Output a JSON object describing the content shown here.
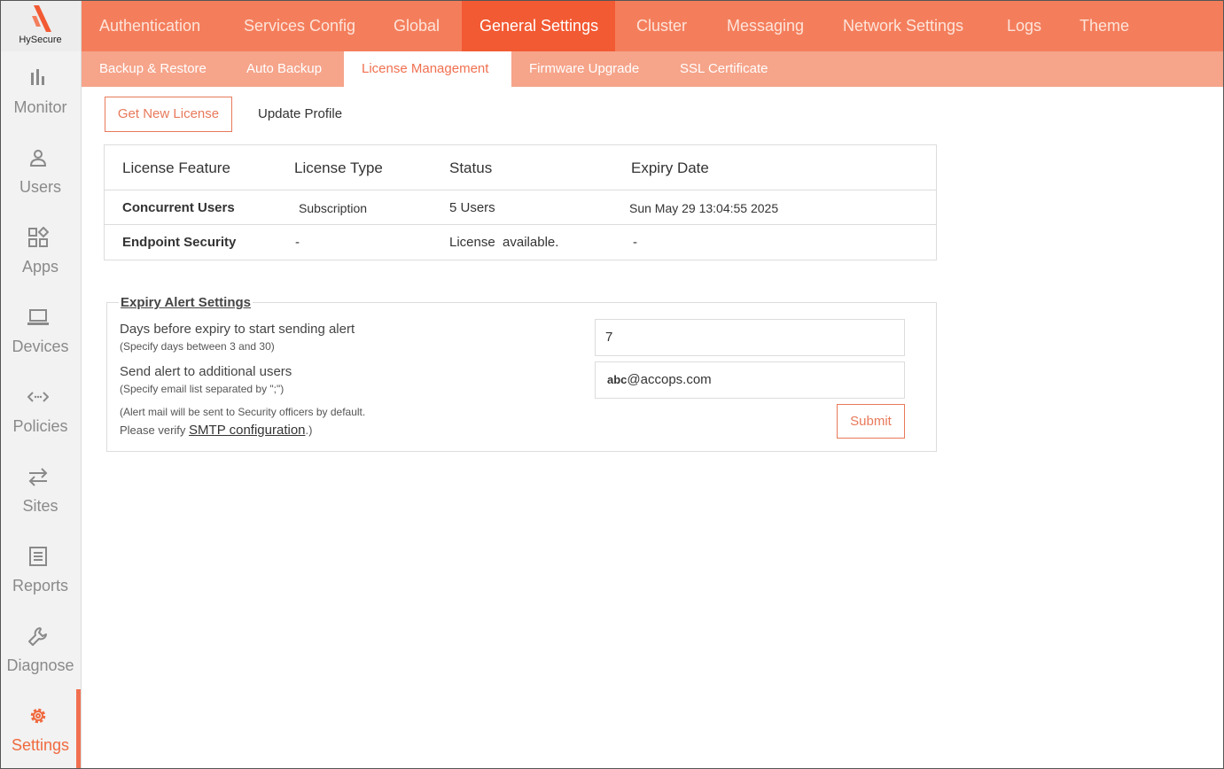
{
  "brand": {
    "name": "HySecure",
    "accent": "#f47e5c",
    "active": "#f25a33"
  },
  "sidebar": {
    "items": [
      {
        "label": "Monitor",
        "icon": "bar-chart-icon"
      },
      {
        "label": "Users",
        "icon": "user-icon"
      },
      {
        "label": "Apps",
        "icon": "apps-icon"
      },
      {
        "label": "Devices",
        "icon": "laptop-icon"
      },
      {
        "label": "Policies",
        "icon": "code-arrows-icon"
      },
      {
        "label": "Sites",
        "icon": "swap-arrows-icon"
      },
      {
        "label": "Reports",
        "icon": "document-icon"
      },
      {
        "label": "Diagnose",
        "icon": "wrench-icon"
      },
      {
        "label": "Settings",
        "icon": "gear-icon",
        "active": true
      }
    ]
  },
  "top_tabs": [
    "Authentication",
    "Services Config",
    "Global",
    "General Settings",
    "Cluster",
    "Messaging",
    "Network Settings",
    "Logs",
    "Theme"
  ],
  "top_tab_active": "General Settings",
  "sub_tabs": [
    "Backup & Restore",
    "Auto Backup",
    "License Management",
    "Firmware Upgrade",
    "SSL Certificate"
  ],
  "sub_tab_active": "License Management",
  "actions": {
    "get_license": "Get New License",
    "update_profile": "Update Profile"
  },
  "license_table": {
    "headers": [
      "License Feature",
      "License Type",
      "Status",
      "Expiry Date"
    ],
    "rows": [
      [
        "Concurrent Users",
        "Subscription",
        "5 Users",
        "Sun May 29 13:04:55 2025"
      ],
      [
        "Endpoint Security",
        "-",
        "License  available.",
        "-"
      ]
    ]
  },
  "alert": {
    "title": "Expiry Alert Settings",
    "days_label": "Days before expiry to start sending alert",
    "days_hint": "(Specify days between 3 and 30)",
    "days_value": "7",
    "users_label": "Send alert to additional users",
    "users_hint": "(Specify email list separated by \";\")",
    "email_prefix": "abc",
    "email_value": "@accops.com",
    "note_line1": "(Alert mail will be sent to Security officers by default.",
    "note_line2_pre": "Please verify ",
    "note_link": "SMTP configuration",
    "note_line2_post": ".)",
    "submit": "Submit"
  }
}
